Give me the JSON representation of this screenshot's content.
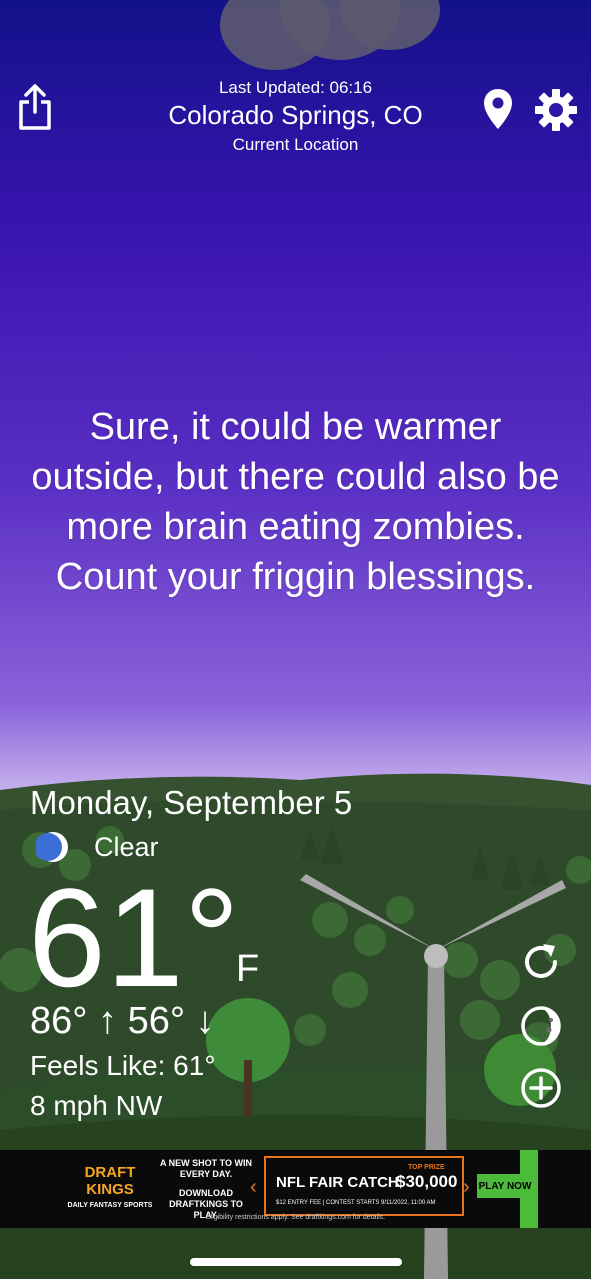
{
  "header": {
    "last_updated": "Last Updated: 06:16",
    "city": "Colorado Springs, CO",
    "location_label": "Current Location"
  },
  "quote": "Sure, it could be warmer outside, but there could also be more brain eating zombies. Count your friggin blessings.",
  "weather": {
    "date": "Monday, September 5",
    "condition": "Clear",
    "condition_icon": "moon-icon",
    "temperature": "61°",
    "unit": "F",
    "hi_lo": "86° ↑ 56° ↓",
    "feels_like": "Feels Like: 61°",
    "wind": "8 mph NW"
  },
  "side_buttons": [
    "refresh-icon",
    "moon-phase-icon",
    "add-icon"
  ],
  "ad": {
    "logo": "DRAFT KINGS",
    "logo_sub": "DAILY FANTASY SPORTS",
    "line1": "A NEW SHOT TO WIN EVERY DAY.",
    "line2": "DOWNLOAD DRAFTKINGS TO PLAY.",
    "headline": "NFL FAIR CATCH",
    "prize_label": "TOP PRIZE",
    "prize": "$30,000",
    "fine_print": "$12 ENTRY FEE  |  CONTEST STARTS 9/11/2022, 11:00 AM",
    "cta": "PLAY NOW",
    "eligibility": "Eligibility restrictions apply. See draftkings.com for details."
  },
  "colors": {
    "sky_top": "#12128a",
    "sky_mid": "#5a2fc4",
    "sky_bottom": "#c7b2ee",
    "hills": "#2f4a2c",
    "accent_ad": "#e8741e"
  }
}
